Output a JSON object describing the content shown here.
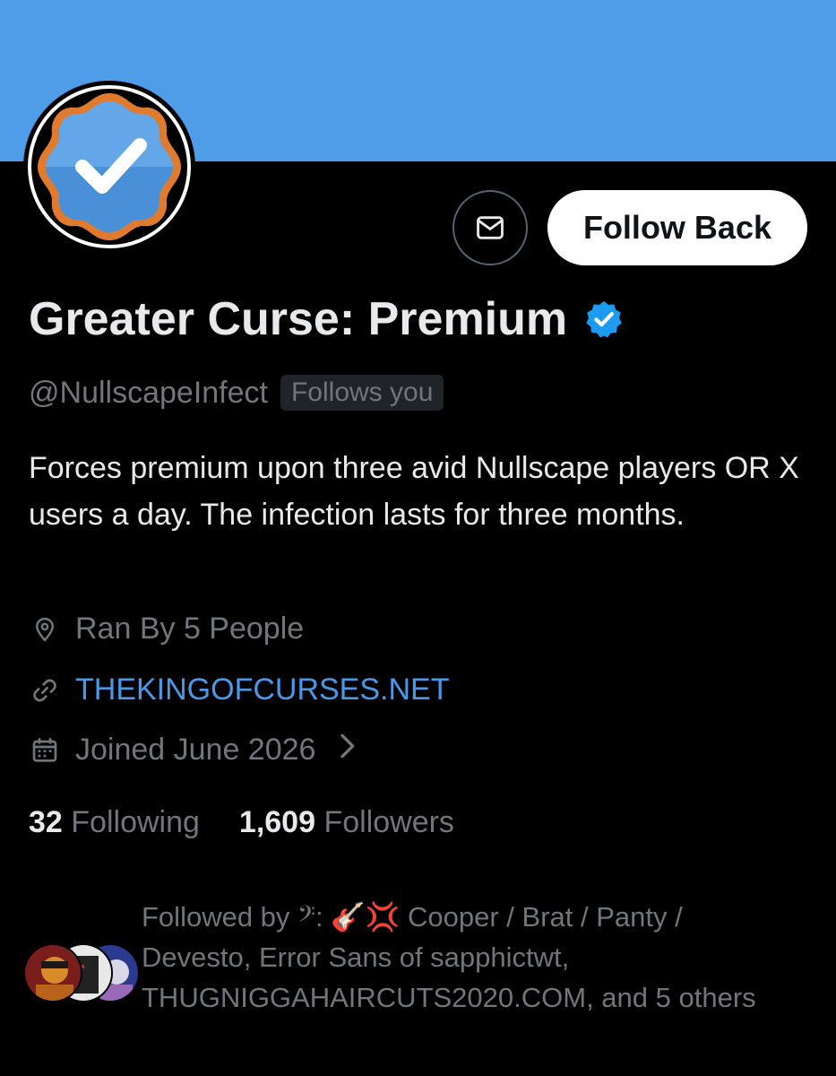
{
  "colors": {
    "banner": "#4f9ce8",
    "accent": "#4a99e9",
    "verified": "#1d9bf0",
    "text_primary": "#e7e9ea",
    "text_secondary": "#71767b"
  },
  "header": {
    "message_icon": "mail-icon",
    "follow_label": "Follow Back"
  },
  "profile": {
    "display_name": "Greater Curse: Premium",
    "handle": "@NullscapeInfect",
    "follows_you": "Follows you",
    "bio": "Forces premium upon three avid Nullscape players OR X users a day. The infection lasts for three months.",
    "location": "Ran By 5 People",
    "website": "THEKINGOFCURSES.NET",
    "joined": "Joined June 2026"
  },
  "stats": {
    "following_count": "32",
    "following_label": "Following",
    "followers_count": "1,609",
    "followers_label": "Followers"
  },
  "followed_by": {
    "text": "Followed by 𝄢: 🎸💢 Cooper / Brat / Panty / Devesto, Error Sans of sapphictwt, THUGNIGGAHAIRCUTS2020.COM, and 5 others"
  }
}
